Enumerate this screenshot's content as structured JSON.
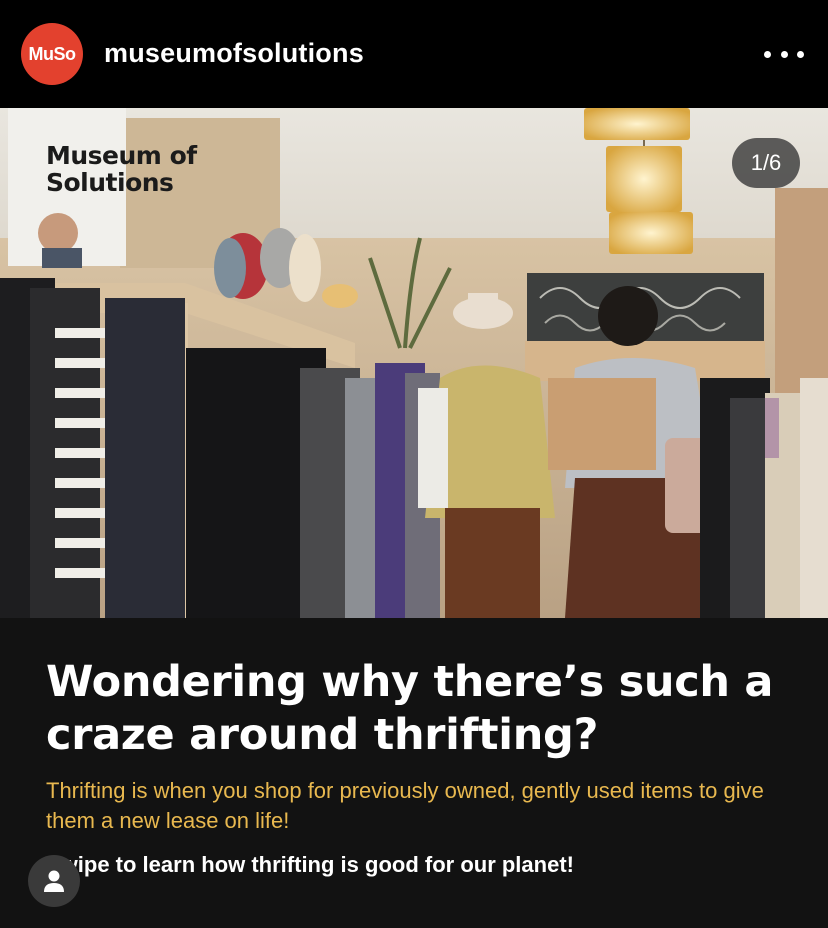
{
  "header": {
    "avatar_text": "MuSo",
    "username": "museumofsolutions",
    "more_icon": "more-horizontal-icon"
  },
  "photo": {
    "counter": "1/6",
    "logo_line1": "Museum of",
    "logo_line2": "Solutions"
  },
  "caption": {
    "headline": "Wondering why there’s such a craze around thrifting?",
    "subtitle": "Thrifting is when you shop for previously owned, gently used items to give them a new lease on life!",
    "cta": "Swipe to learn how thrifting is good for our planet!"
  },
  "overlay": {
    "user_icon": "person-icon"
  },
  "colors": {
    "brand": "#e3412e",
    "accent_text": "#e8b84f",
    "panel_bg": "#121212"
  }
}
